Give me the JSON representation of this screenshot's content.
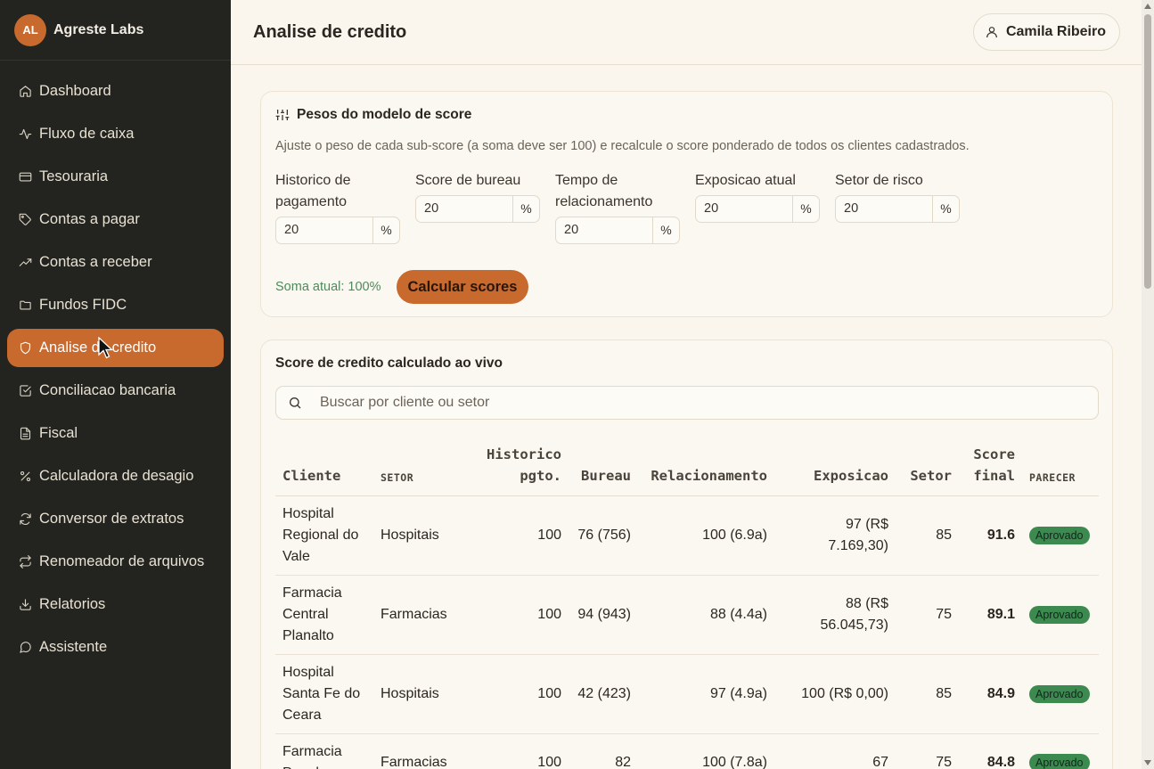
{
  "app": {
    "initials": "AL",
    "name": "Agreste Labs"
  },
  "sidebar": {
    "items": [
      {
        "label": "Dashboard",
        "icon": "home-icon",
        "active": false
      },
      {
        "label": "Fluxo de caixa",
        "icon": "activity-icon",
        "active": false
      },
      {
        "label": "Tesouraria",
        "icon": "credit-card-icon",
        "active": false
      },
      {
        "label": "Contas a pagar",
        "icon": "tag-icon",
        "active": false
      },
      {
        "label": "Contas a receber",
        "icon": "trending-up-icon",
        "active": false
      },
      {
        "label": "Fundos FIDC",
        "icon": "folder-icon",
        "active": false
      },
      {
        "label": "Analise de credito",
        "icon": "shield-icon",
        "active": true
      },
      {
        "label": "Conciliacao bancaria",
        "icon": "check-square-icon",
        "active": false
      },
      {
        "label": "Fiscal",
        "icon": "file-text-icon",
        "active": false
      },
      {
        "label": "Calculadora de desagio",
        "icon": "percent-icon",
        "active": false
      },
      {
        "label": "Conversor de extratos",
        "icon": "refresh-icon",
        "active": false
      },
      {
        "label": "Renomeador de arquivos",
        "icon": "repeat-icon",
        "active": false
      },
      {
        "label": "Relatorios",
        "icon": "download-icon",
        "active": false
      },
      {
        "label": "Assistente",
        "icon": "message-circle-icon",
        "active": false
      }
    ]
  },
  "header": {
    "title": "Analise de credito",
    "user": "Camila Ribeiro"
  },
  "weights_card": {
    "title": "Pesos do modelo de score",
    "description": "Ajuste o peso de cada sub-score (a soma deve ser 100) e recalcule o score ponderado de todos os clientes cadastrados.",
    "fields": [
      {
        "label": "Historico de pagamento",
        "value": "20",
        "unit": "%"
      },
      {
        "label": "Score de bureau",
        "value": "20",
        "unit": "%"
      },
      {
        "label": "Tempo de relacionamento",
        "value": "20",
        "unit": "%"
      },
      {
        "label": "Exposicao atual",
        "value": "20",
        "unit": "%"
      },
      {
        "label": "Setor de risco",
        "value": "20",
        "unit": "%"
      }
    ],
    "sum_text": "Soma atual: 100%",
    "button_label": "Calcular scores"
  },
  "scores_card": {
    "title": "Score de credito calculado ao vivo",
    "search_placeholder": "Buscar por cliente ou setor",
    "columns": {
      "cliente": "Cliente",
      "setor": "SETOR",
      "historico": "Historico pgto.",
      "bureau": "Bureau",
      "relacionamento": "Relacionamento",
      "exposicao": "Exposicao",
      "setor_score": "Setor",
      "final": "Score final",
      "parecer": "PARECER"
    },
    "rows": [
      {
        "cliente": "Hospital Regional do Vale",
        "setor": "Hospitais",
        "historico": "100",
        "bureau": "76 (756)",
        "relacionamento": "100 (6.9a)",
        "exposicao": "97 (R$ 7.169,30)",
        "setor_score": "85",
        "final": "91.6",
        "parecer": "Aprovado"
      },
      {
        "cliente": "Farmacia Central Planalto",
        "setor": "Farmacias",
        "historico": "100",
        "bureau": "94 (943)",
        "relacionamento": "88 (4.4a)",
        "exposicao": "88 (R$ 56.045,73)",
        "setor_score": "75",
        "final": "89.1",
        "parecer": "Aprovado"
      },
      {
        "cliente": "Hospital Santa Fe do Ceara",
        "setor": "Hospitais",
        "historico": "100",
        "bureau": "42 (423)",
        "relacionamento": "97 (4.9a)",
        "exposicao": "100 (R$ 0,00)",
        "setor_score": "85",
        "final": "84.9",
        "parecer": "Aprovado"
      },
      {
        "cliente": "Farmacia Popular",
        "setor": "Farmacias",
        "historico": "100",
        "bureau": "82",
        "relacionamento": "100 (7.8a)",
        "exposicao": "67",
        "setor_score": "75",
        "final": "84.8",
        "parecer": "Aprovado"
      }
    ]
  },
  "colors": {
    "accent": "#c8692e",
    "sidebar_bg": "#23231f",
    "page_bg": "#faf6ee",
    "success": "#3d8a50"
  }
}
